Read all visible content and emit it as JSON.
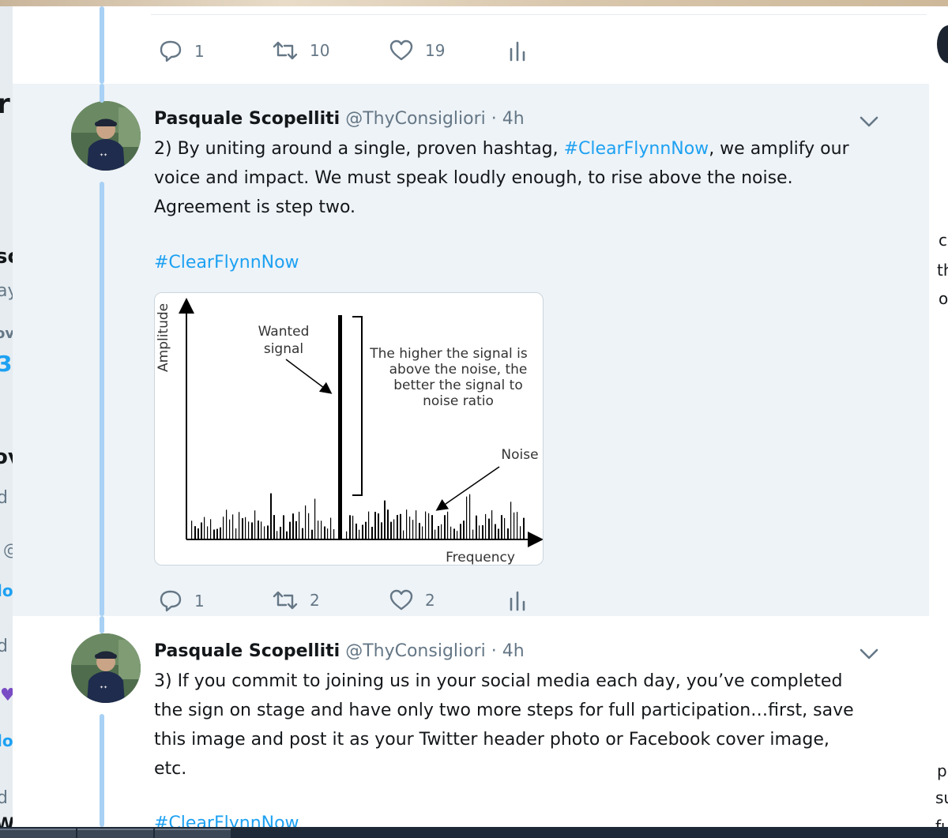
{
  "tweets": [
    {
      "stats": {
        "replies": "1",
        "retweets": "10",
        "likes": "19"
      }
    },
    {
      "author_name": "Pasquale Scopelliti",
      "author_handle": "@ThyConsigliori",
      "time_sep": "·",
      "time": "4h",
      "text_lines": [
        {
          "pre": "2) By uniting around a single, proven hashtag, ",
          "tag": "#ClearFlynnNow",
          "post": ", we amplify our"
        },
        {
          "pre": "voice and impact.  We must speak loudly enough, to rise above the noise."
        },
        {
          "pre": "Agreement is step two."
        }
      ],
      "hashtag_line": "#ClearFlynnNow",
      "media": {
        "y_axis_label": "Amplitude",
        "x_axis_label": "Frequency",
        "wanted_signal_label": [
          "Wanted",
          "signal"
        ],
        "ratio_note": [
          "The higher the signal is",
          "above the noise, the",
          "better the signal to",
          "noise ratio"
        ],
        "noise_label": "Noise"
      },
      "stats": {
        "replies": "1",
        "retweets": "2",
        "likes": "2"
      }
    },
    {
      "author_name": "Pasquale Scopelliti",
      "author_handle": "@ThyConsigliori",
      "time_sep": "·",
      "time": "4h",
      "text_lines": [
        {
          "pre": "3) If you commit to joining us in your social media each day, you’ve completed"
        },
        {
          "pre": "the sign on stage and have only two more steps for full participation…first, save"
        },
        {
          "pre": "this image and post it as your Twitter header photo or Facebook cover image,"
        },
        {
          "pre": "etc."
        }
      ],
      "hashtag_line": "#ClearFlynnNow"
    }
  ],
  "background": {
    "left_fragments": [
      "r",
      "sc",
      "ay",
      "ov",
      "3",
      "ov",
      "d",
      "@",
      "lo",
      "d",
      "lo",
      "d",
      "W"
    ],
    "right_fragments": [
      "c",
      "th",
      "o",
      "p",
      "su",
      "fu"
    ]
  },
  "colors": {
    "accent": "#1da1f2",
    "thread_line": "#a8d1f5",
    "highlight_bg": "#eef3f7",
    "muted": "#657786"
  }
}
